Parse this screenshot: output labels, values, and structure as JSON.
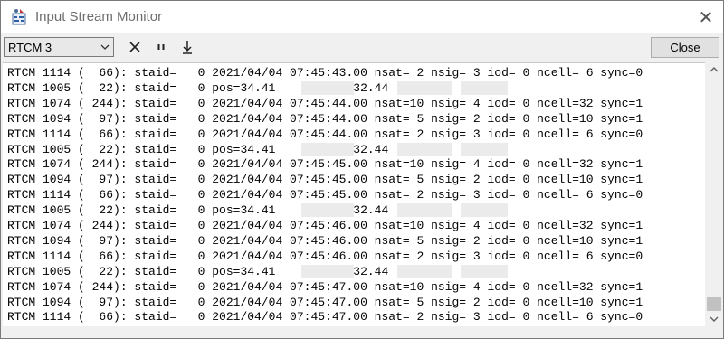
{
  "window": {
    "title": "Input Stream Monitor"
  },
  "toolbar": {
    "stream_select": "RTCM 3",
    "clear_label": "✕",
    "pause_label": "ıı",
    "scroll_label": "⭳",
    "close_label": "Close"
  },
  "log_lines": [
    "RTCM 1114 (  66): staid=   0 2021/04/04 07:45:43.00 nsat= 2 nsig= 3 iod= 0 ncell= 6 sync=0",
    "RTCM 1005 (  22): staid=   0 pos=34.41          132.44            1",
    "RTCM 1074 ( 244): staid=   0 2021/04/04 07:45:44.00 nsat=10 nsig= 4 iod= 0 ncell=32 sync=1",
    "RTCM 1094 (  97): staid=   0 2021/04/04 07:45:44.00 nsat= 5 nsig= 2 iod= 0 ncell=10 sync=1",
    "RTCM 1114 (  66): staid=   0 2021/04/04 07:45:44.00 nsat= 2 nsig= 3 iod= 0 ncell= 6 sync=0",
    "RTCM 1005 (  22): staid=   0 pos=34.41          132.44            1",
    "RTCM 1074 ( 244): staid=   0 2021/04/04 07:45:45.00 nsat=10 nsig= 4 iod= 0 ncell=32 sync=1",
    "RTCM 1094 (  97): staid=   0 2021/04/04 07:45:45.00 nsat= 5 nsig= 2 iod= 0 ncell=10 sync=1",
    "RTCM 1114 (  66): staid=   0 2021/04/04 07:45:45.00 nsat= 2 nsig= 3 iod= 0 ncell= 6 sync=0",
    "RTCM 1005 (  22): staid=   0 pos=34.41          132.44            1",
    "RTCM 1074 ( 244): staid=   0 2021/04/04 07:45:46.00 nsat=10 nsig= 4 iod= 0 ncell=32 sync=1",
    "RTCM 1094 (  97): staid=   0 2021/04/04 07:45:46.00 nsat= 5 nsig= 2 iod= 0 ncell=10 sync=1",
    "RTCM 1114 (  66): staid=   0 2021/04/04 07:45:46.00 nsat= 2 nsig= 3 iod= 0 ncell= 6 sync=0",
    "RTCM 1005 (  22): staid=   0 pos=34.41          132.44            1",
    "RTCM 1074 ( 244): staid=   0 2021/04/04 07:45:47.00 nsat=10 nsig= 4 iod= 0 ncell=32 sync=1",
    "RTCM 1094 (  97): staid=   0 2021/04/04 07:45:47.00 nsat= 5 nsig= 2 iod= 0 ncell=10 sync=1",
    "RTCM 1114 (  66): staid=   0 2021/04/04 07:45:47.00 nsat= 2 nsig= 3 iod= 0 ncell= 6 sync=0"
  ]
}
